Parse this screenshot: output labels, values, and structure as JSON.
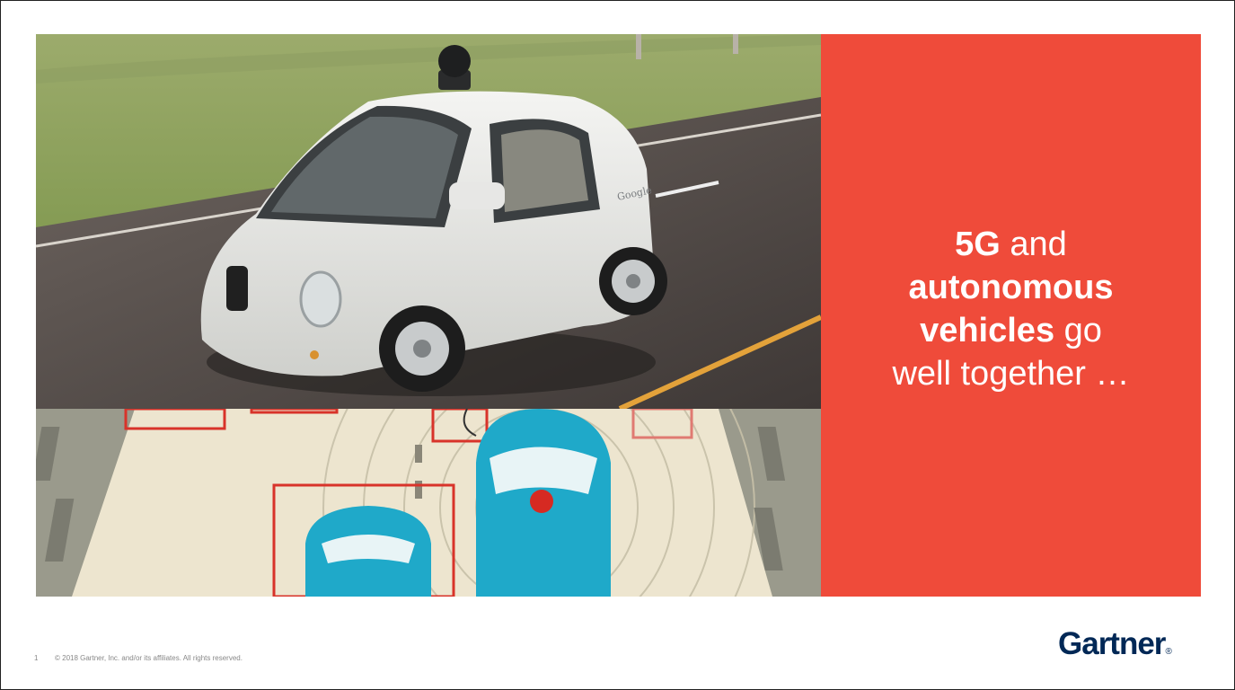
{
  "slide": {
    "headline_parts": [
      {
        "text": "5G",
        "bold": true
      },
      {
        "text": " and ",
        "bold": false
      },
      {
        "text": "autonomous",
        "bold": true
      },
      {
        "text": " ",
        "bold": false
      },
      {
        "text": "vehicles",
        "bold": true
      },
      {
        "text": " go well together …",
        "bold": false
      }
    ],
    "page_number": "1",
    "copyright": "© 2018 Gartner, Inc. and/or its affiliates. All rights reserved.",
    "logo_text": "Gartner",
    "logo_mark": "®",
    "car_badge": "Google"
  },
  "colors": {
    "accent_red": "#ef4b3a",
    "logo_navy": "#002856",
    "illustration_blue": "#1fa9c9"
  }
}
